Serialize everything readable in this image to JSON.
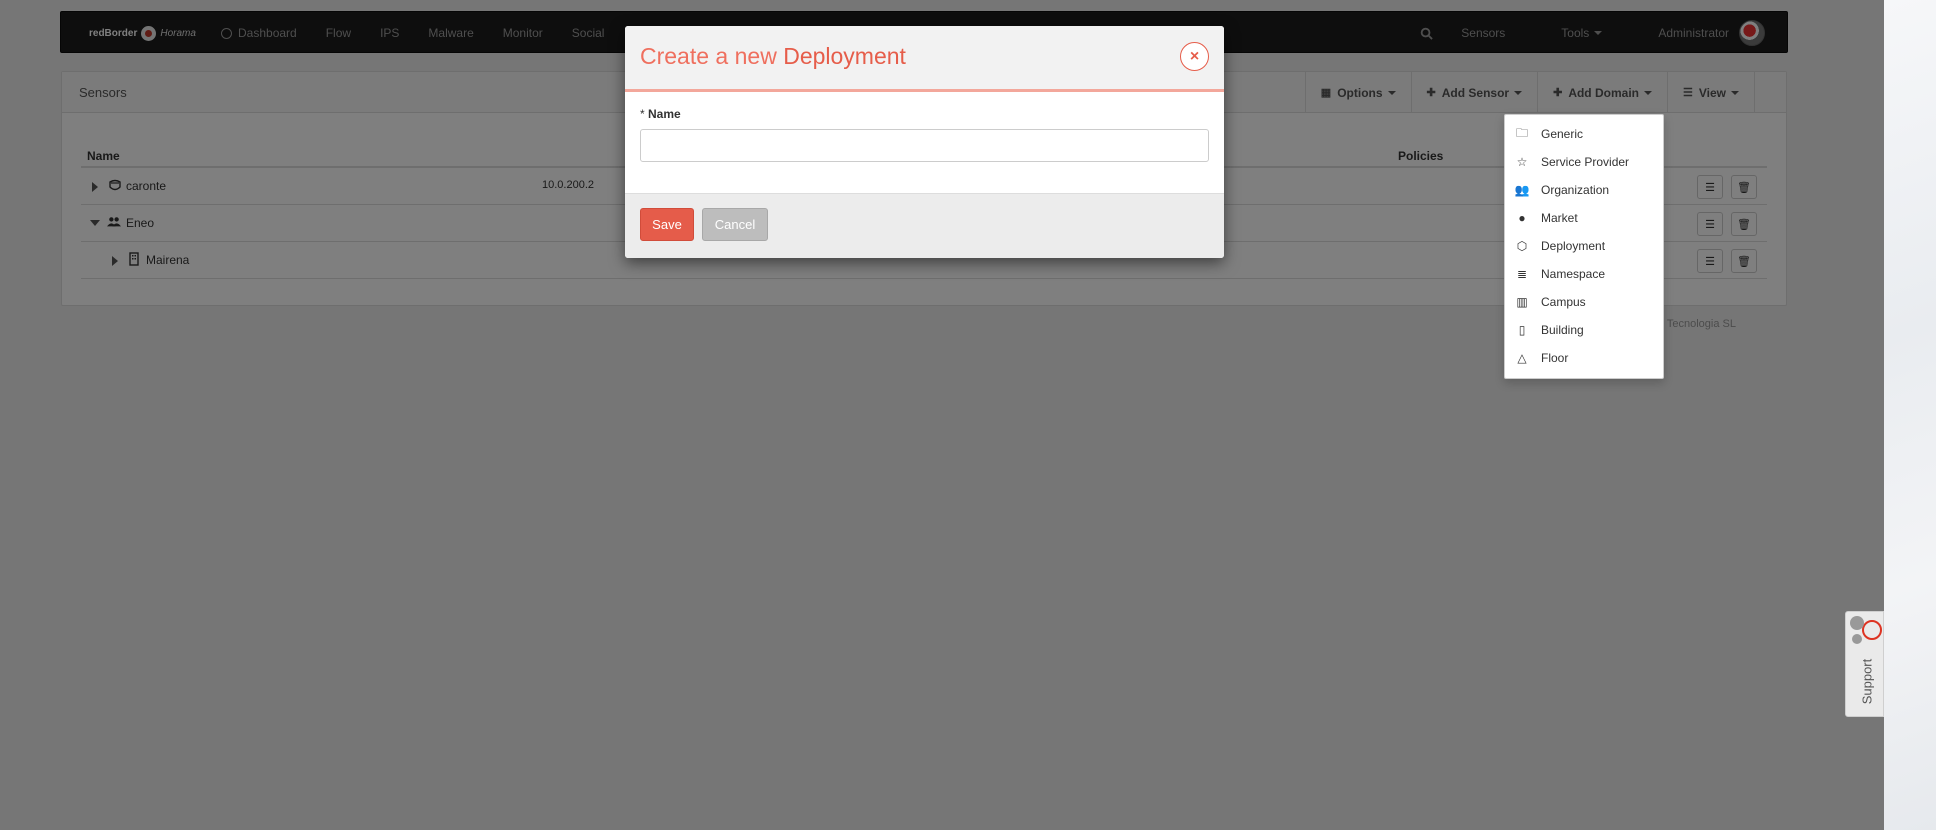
{
  "navbar": {
    "brand": "redBorder",
    "brand_sub": "Horama",
    "links": [
      "Dashboard",
      "Flow",
      "IPS",
      "Malware",
      "Monitor",
      "Social"
    ],
    "right": {
      "sensors": "Sensors",
      "tools": "Tools",
      "user": "Administrator"
    }
  },
  "panel": {
    "title": "Sensors",
    "toolbar": {
      "options": "Options",
      "add_sensor": "Add Sensor",
      "add_domain": "Add Domain",
      "view": "View"
    },
    "columns": {
      "name": "Name",
      "policies": "Policies"
    },
    "rows": [
      {
        "name": "caronte",
        "ip": "10.0.200.2",
        "icon": "sensor-icon"
      },
      {
        "name": "Eneo",
        "icon": "users-icon"
      },
      {
        "name": "Mairena",
        "icon": "building-icon"
      }
    ]
  },
  "footer": "2015 ENEO Tecnologia SL",
  "dropdown": {
    "items": [
      "Generic",
      "Service Provider",
      "Organization",
      "Market",
      "Deployment",
      "Namespace",
      "Campus",
      "Building",
      "Floor"
    ]
  },
  "modal": {
    "title_prefix": "Create a new",
    "title_entity": "Deployment",
    "close": "×",
    "field_required": "*",
    "field_label": "Name",
    "field_value": "",
    "save": "Save",
    "cancel": "Cancel"
  },
  "support": {
    "label": "Support"
  },
  "colors": {
    "accent": "#e65d4a",
    "navbar": "#1c1c1c"
  }
}
